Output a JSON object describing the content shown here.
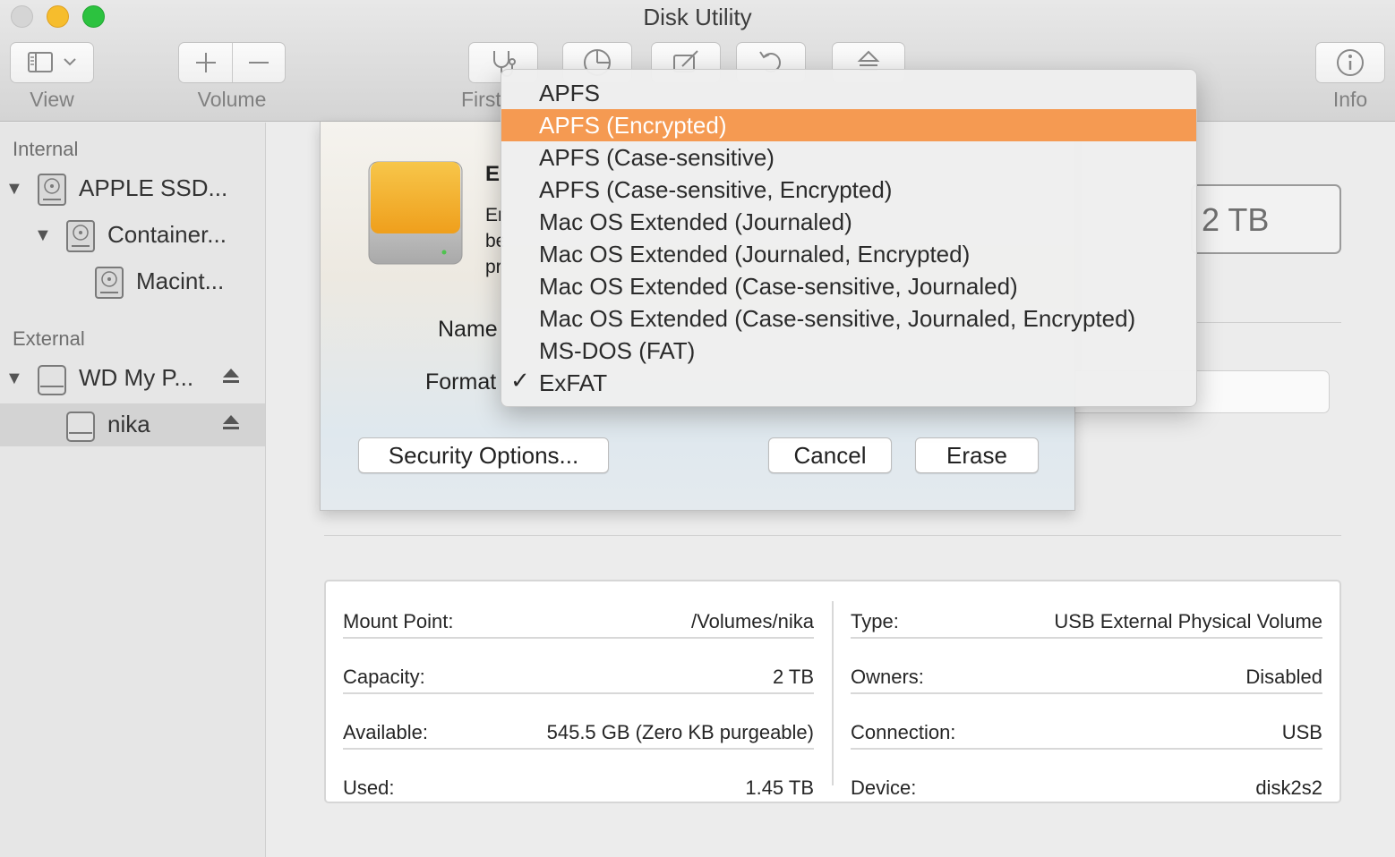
{
  "window": {
    "title": "Disk Utility"
  },
  "toolbar": {
    "view_label": "View",
    "volume_label": "Volume",
    "first_aid_label": "First",
    "info_label": "Info"
  },
  "sidebar": {
    "internal_header": "Internal",
    "external_header": "External",
    "items": [
      {
        "label": "APPLE SSD...",
        "icon": "internal-disk-icon"
      },
      {
        "label": "Container...",
        "icon": "internal-disk-icon"
      },
      {
        "label": "Macint...",
        "icon": "internal-disk-icon"
      },
      {
        "label": "WD My P...",
        "icon": "external-disk-icon"
      },
      {
        "label": "nika",
        "icon": "external-disk-icon",
        "selected": true
      }
    ]
  },
  "main": {
    "capacity_display": "2 TB"
  },
  "sheet": {
    "title": "E",
    "desc_lines": [
      "Er",
      "be",
      "pr"
    ],
    "name_label": "Name",
    "format_label": "Format",
    "security_options": "Security Options...",
    "cancel": "Cancel",
    "erase": "Erase"
  },
  "format_menu": {
    "items": [
      "APFS",
      "APFS (Encrypted)",
      "APFS (Case-sensitive)",
      "APFS (Case-sensitive, Encrypted)",
      "Mac OS Extended (Journaled)",
      "Mac OS Extended (Journaled, Encrypted)",
      "Mac OS Extended (Case-sensitive, Journaled)",
      "Mac OS Extended (Case-sensitive, Journaled, Encrypted)",
      "MS-DOS (FAT)",
      "ExFAT"
    ],
    "highlighted": "APFS (Encrypted)",
    "checked": "ExFAT",
    "check_glyph": "✓",
    "highlight_color": "#f59a52"
  },
  "info": {
    "left": [
      {
        "key": "Mount Point:",
        "value": "/Volumes/nika"
      },
      {
        "key": "Capacity:",
        "value": "2 TB"
      },
      {
        "key": "Available:",
        "value": "545.5 GB (Zero KB purgeable)"
      },
      {
        "key": "Used:",
        "value": "1.45 TB"
      }
    ],
    "right": [
      {
        "key": "Type:",
        "value": "USB External Physical Volume"
      },
      {
        "key": "Owners:",
        "value": "Disabled"
      },
      {
        "key": "Connection:",
        "value": "USB"
      },
      {
        "key": "Device:",
        "value": "disk2s2"
      }
    ]
  }
}
